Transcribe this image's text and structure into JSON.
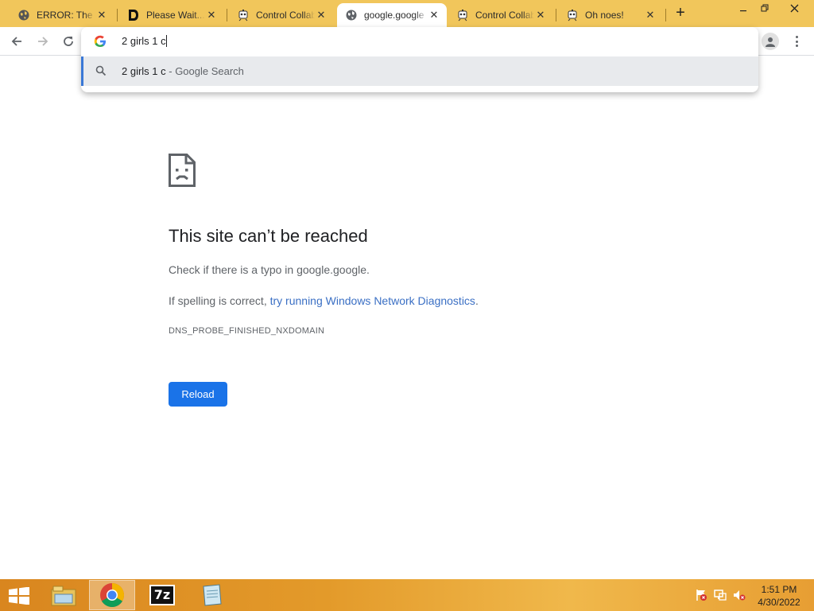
{
  "tabs": [
    {
      "title": "ERROR: The re",
      "favicon": "globe-icon",
      "active": false
    },
    {
      "title": "Please Wait...",
      "favicon": "d-logo-icon",
      "active": false
    },
    {
      "title": "Control Collab",
      "favicon": "robot-icon",
      "active": false
    },
    {
      "title": "google.google",
      "favicon": "globe-icon",
      "active": true
    },
    {
      "title": "Control Collab",
      "favicon": "robot-icon",
      "active": false
    },
    {
      "title": "Oh noes!",
      "favicon": "robot-icon",
      "active": false
    }
  ],
  "new_tab_label": "+",
  "omnibox": {
    "text": "2 girls 1 c",
    "suggestion": {
      "query": "2 girls 1 c",
      "suffix": " - Google Search"
    }
  },
  "error": {
    "title": "This site can’t be reached",
    "line1": "Check if there is a typo in google.google.",
    "line2_prefix": "If spelling is correct, ",
    "line2_link": "try running Windows Network Diagnostics",
    "line2_suffix": ".",
    "code": "DNS_PROBE_FINISHED_NXDOMAIN",
    "reload_label": "Reload"
  },
  "taskbar": {
    "apps": [
      "file-explorer-icon",
      "chrome-icon",
      "7zip-icon",
      "notepad-icon"
    ],
    "seven_zip_label": "7z",
    "time": "1:51 PM",
    "date": "4/30/2022"
  },
  "colors": {
    "tabstrip": "#f1c65b",
    "accent": "#1a73e8",
    "link": "#3a6fc4",
    "taskbar": "#e39a2a"
  }
}
